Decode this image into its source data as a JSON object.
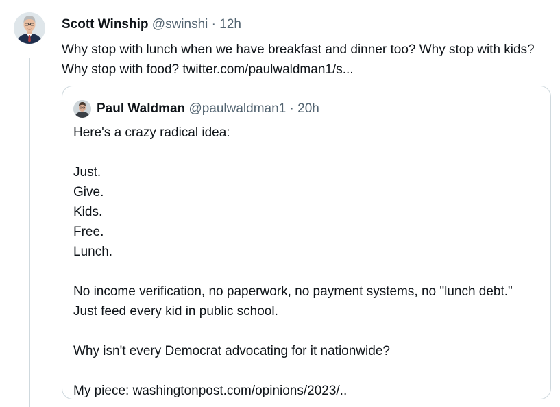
{
  "tweet": {
    "author_name": "Scott Winship",
    "author_handle": "@swinshi",
    "separator": "·",
    "time": "12h",
    "text": "Why stop with lunch when we have breakfast and dinner too? Why stop with kids? Why stop with food? twitter.com/paulwaldman1/s..."
  },
  "quoted": {
    "author_name": "Paul Waldman",
    "author_handle": "@paulwaldman1",
    "separator": "·",
    "time": "20h",
    "lines": {
      "l1": "Here's a crazy radical idea:",
      "l2": "Just.",
      "l3": "Give.",
      "l4": "Kids.",
      "l5": "Free.",
      "l6": "Lunch.",
      "l7": "No income verification, no paperwork, no payment systems, no \"lunch debt.\" Just feed every kid in public school.",
      "l8": "Why isn't every Democrat advocating for it nationwide?",
      "l9": "My piece: washingtonpost.com/opinions/2023/.."
    }
  },
  "colors": {
    "text": "#0f1419",
    "secondary": "#536471",
    "border": "#cfd9de"
  }
}
